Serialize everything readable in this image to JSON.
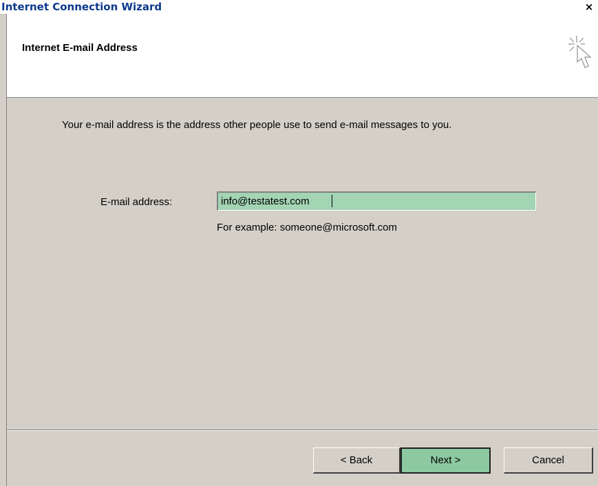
{
  "window": {
    "title": "Internet Connection Wizard",
    "close_label": "×"
  },
  "header": {
    "title": "Internet E-mail Address",
    "icon": "wizard-cursor-icon"
  },
  "content": {
    "description": "Your e-mail address is the address other people use to send e-mail messages to you.",
    "email_label": "E-mail address:",
    "email_value": "info@testatest.com",
    "example_text": "For example: someone@microsoft.com"
  },
  "buttons": {
    "back": "< Back",
    "next": "Next >",
    "cancel": "Cancel"
  },
  "colors": {
    "title_text": "#0d3a8c",
    "dialog_face": "#d4d0c8",
    "input_highlight": "#a3d4b4",
    "next_highlight": "#8cc8a0"
  }
}
